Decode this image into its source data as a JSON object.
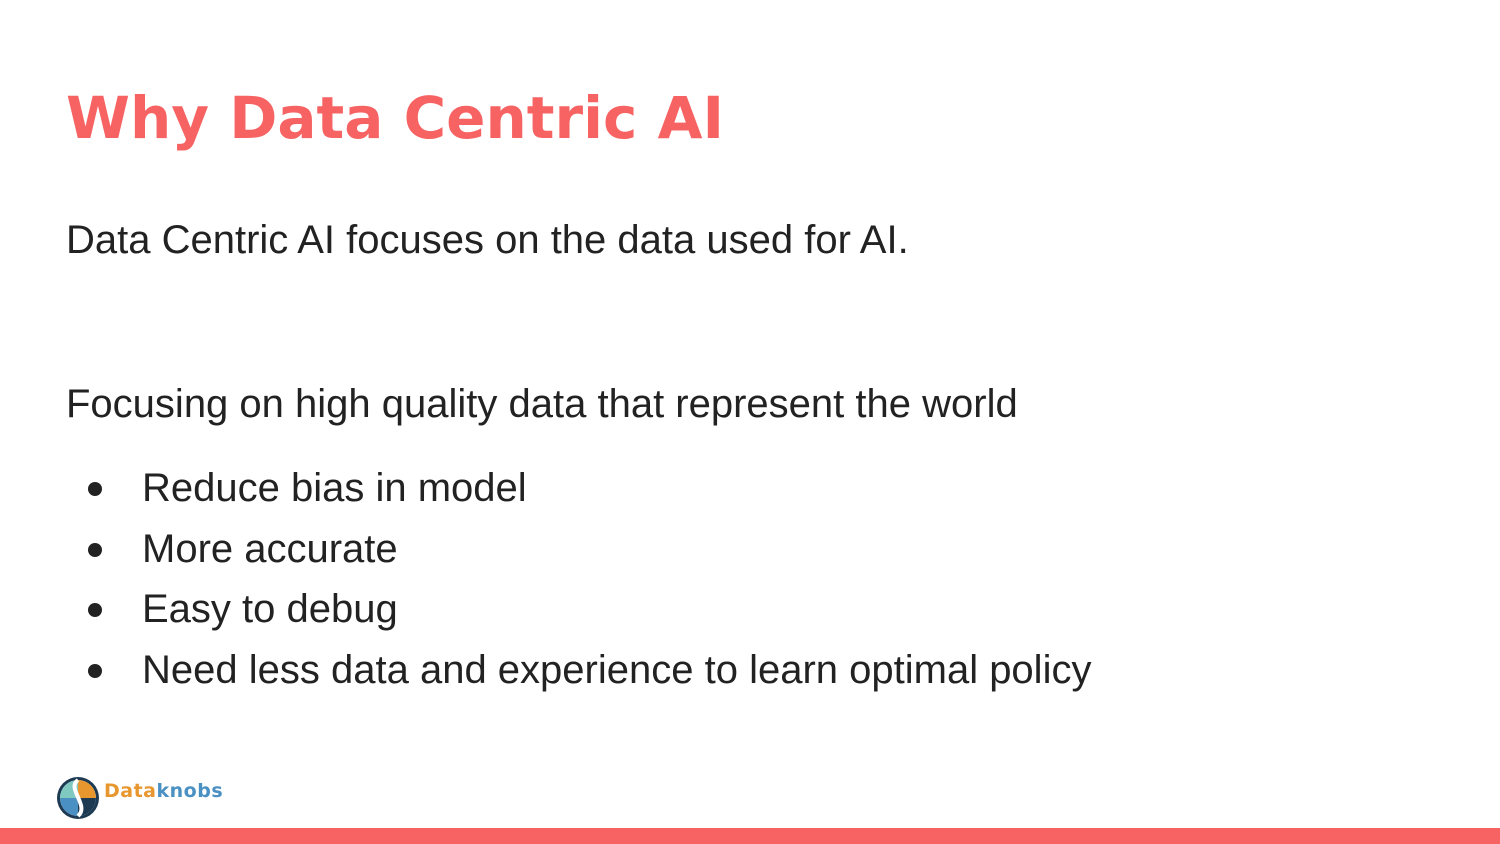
{
  "slide": {
    "title": "Why Data Centric AI",
    "paragraph_1": "Data Centric AI focuses on the data used for AI.",
    "paragraph_2": "Focusing on high quality data that represent the world",
    "bullets": [
      "Reduce bias in model",
      "More accurate",
      "Easy to debug",
      "Need less data and experience to learn optimal policy"
    ]
  },
  "logo": {
    "text_part_1": "Data",
    "text_part_2": "knobs",
    "icon": "dataknobs-logo-icon"
  },
  "colors": {
    "accent": "#f76363",
    "body_text": "#222222",
    "logo_orange": "#e8962e",
    "logo_blue": "#4a90c2",
    "logo_navy": "#1d3a52",
    "logo_teal": "#7fc9c0"
  }
}
